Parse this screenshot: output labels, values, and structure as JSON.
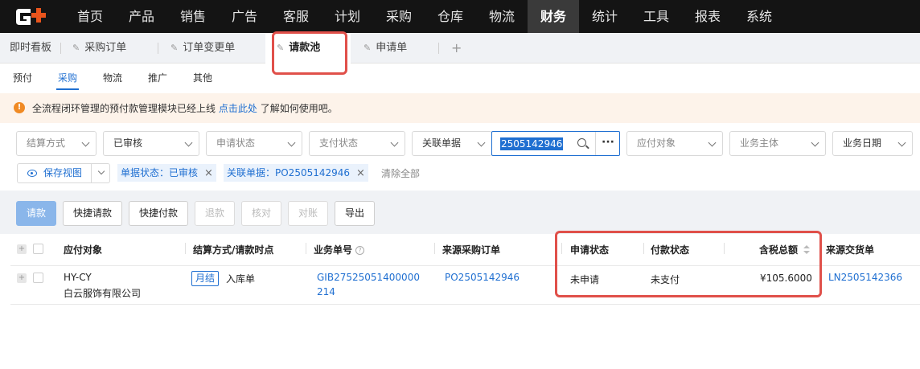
{
  "nav": {
    "items": [
      "首页",
      "产品",
      "销售",
      "广告",
      "客服",
      "计划",
      "采购",
      "仓库",
      "物流",
      "财务",
      "统计",
      "工具",
      "报表",
      "系统"
    ],
    "active": "财务"
  },
  "tabs": {
    "items": [
      "即时看板",
      "采购订单",
      "订单变更单",
      "请款池",
      "申请单"
    ],
    "active": "请款池",
    "add": "+"
  },
  "subtabs": {
    "items": [
      "预付",
      "采购",
      "物流",
      "推广",
      "其他"
    ],
    "active": "采购"
  },
  "notice": {
    "icon": "!",
    "text": "全流程闭环管理的预付款管理模块已经上线",
    "link": "点击此处",
    "suffix": "了解如何使用吧。"
  },
  "filters": {
    "settle": "结算方式",
    "audit": "已审核",
    "apply_status": "申请状态",
    "pay_status": "支付状态",
    "related": "关联单据",
    "search_value": "2505142946",
    "pay_target": "应付对象",
    "entity": "业务主体",
    "biz_date": "业务日期"
  },
  "view": {
    "save_label": "保存视图",
    "chips": [
      "单据状态：已审核",
      "关联单据：PO2505142946"
    ],
    "clear_all": "清除全部"
  },
  "toolbar": {
    "buttons": [
      "请款",
      "快捷请款",
      "快捷付款",
      "退款",
      "核对",
      "对账",
      "导出"
    ]
  },
  "table": {
    "headers": [
      "应付对象",
      "结算方式/请款时点",
      "业务单号",
      "来源采购订单",
      "申请状态",
      "付款状态",
      "含税总额",
      "来源交货单"
    ],
    "rows": [
      {
        "target_code": "HY-CY",
        "target_name": "白云服饰有限公司",
        "settle_tag": "月结",
        "settle_point": "入库单",
        "biz_no_1": "GIB27525051400000",
        "biz_no_2": "214",
        "source_po": "PO2505142946",
        "apply_status": "未申请",
        "pay_status": "未支付",
        "amount": "¥105.6000",
        "source_delivery": "LN2505142366"
      }
    ]
  },
  "colors": {
    "accent": "#1f6fd1",
    "highlight": "#e0504a",
    "nav_bg": "#141414"
  }
}
